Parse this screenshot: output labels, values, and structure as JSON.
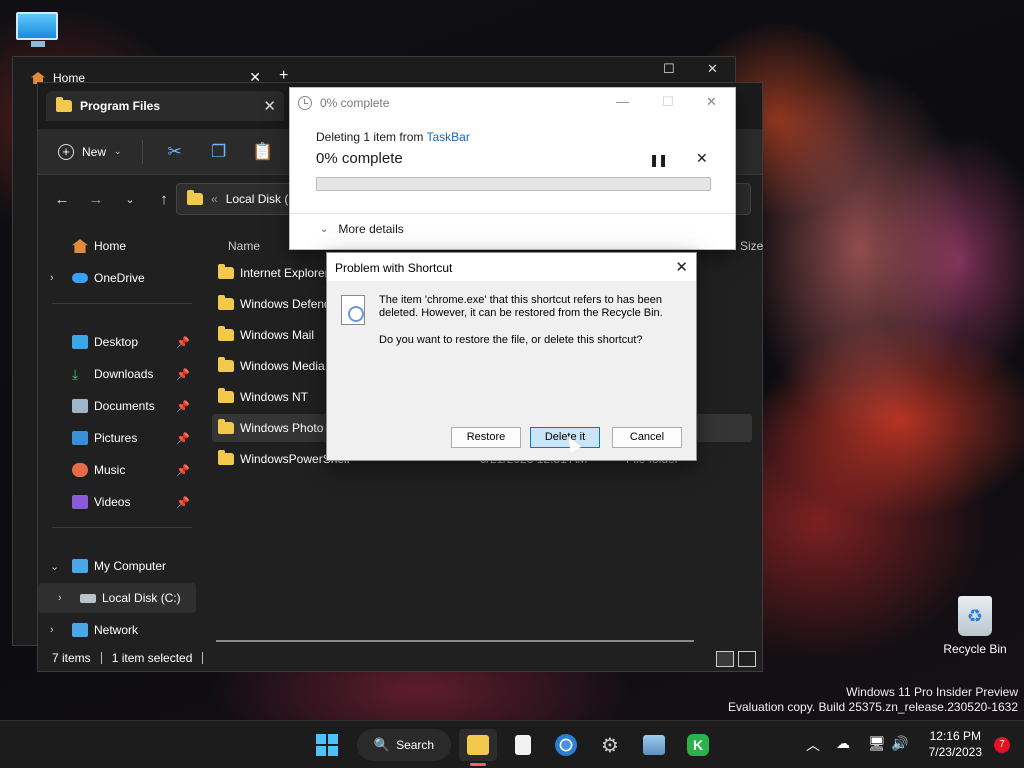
{
  "desktop": {
    "recycle_bin_label": "Recycle Bin",
    "watermark_line1": "Windows 11 Pro Insider Preview",
    "watermark_line2": "Evaluation copy. Build 25375.zn_release.230520-1632"
  },
  "background_window": {
    "tab_title": "Home",
    "new_tab": "+"
  },
  "explorer": {
    "tab_title": "Program Files",
    "toolbar": {
      "new_label": "New"
    },
    "address": "Local Disk (C",
    "sidebar": {
      "items": [
        {
          "label": "Home",
          "icon": "home-icon",
          "pinned": false,
          "expandable": false
        },
        {
          "label": "OneDrive",
          "icon": "cloud-icon",
          "pinned": false,
          "expandable": true
        },
        {
          "label": "Desktop",
          "icon": "desktop-icon",
          "pinned": true,
          "expandable": false
        },
        {
          "label": "Downloads",
          "icon": "download-icon",
          "pinned": true,
          "expandable": false
        },
        {
          "label": "Documents",
          "icon": "document-icon",
          "pinned": true,
          "expandable": false
        },
        {
          "label": "Pictures",
          "icon": "picture-icon",
          "pinned": true,
          "expandable": false
        },
        {
          "label": "Music",
          "icon": "music-icon",
          "pinned": true,
          "expandable": false
        },
        {
          "label": "Videos",
          "icon": "video-icon",
          "pinned": true,
          "expandable": false
        },
        {
          "label": "My Computer",
          "icon": "computer-icon",
          "pinned": false,
          "expandable": true
        },
        {
          "label": "Local Disk (C:)",
          "icon": "drive-icon",
          "pinned": false,
          "expandable": true
        },
        {
          "label": "Network",
          "icon": "network-icon",
          "pinned": false,
          "expandable": true
        }
      ]
    },
    "columns": {
      "name": "Name",
      "size": "Size"
    },
    "files": [
      {
        "name": "Internet Explorer",
        "date": "",
        "type": ""
      },
      {
        "name": "Windows Defend",
        "date": "",
        "type": ""
      },
      {
        "name": "Windows Mail",
        "date": "",
        "type": ""
      },
      {
        "name": "Windows Media I",
        "date": "",
        "type": ""
      },
      {
        "name": "Windows NT",
        "date": "",
        "type": ""
      },
      {
        "name": "Windows Photo V",
        "date": "",
        "type": ""
      },
      {
        "name": "WindowsPowerShell",
        "date": "5/21/2023 12:51 AM",
        "type": "File folder"
      }
    ],
    "status": {
      "count": "7 items",
      "selected": "1 item selected"
    }
  },
  "progress_dialog": {
    "title": "0% complete",
    "line_prefix": "Deleting 1 item from ",
    "line_link": "TaskBar",
    "percent_text": "0% complete",
    "progress": 0,
    "more_details": "More details"
  },
  "shortcut_dialog": {
    "title": "Problem with Shortcut",
    "message": "The item 'chrome.exe' that this shortcut refers to has been deleted. However, it can be restored from the Recycle Bin.",
    "question": "Do you want to restore the file, or delete this shortcut?",
    "restore_label": "Restore",
    "delete_label": "Delete it",
    "cancel_label": "Cancel"
  },
  "taskbar": {
    "search_label": "Search",
    "time": "12:16 PM",
    "date": "7/23/2023",
    "notification_count": "7"
  },
  "colors": {
    "accent": "#4cc2ff",
    "folder": "#f2c94c",
    "progress_fill": "#06b025",
    "link": "#1a66c2"
  }
}
